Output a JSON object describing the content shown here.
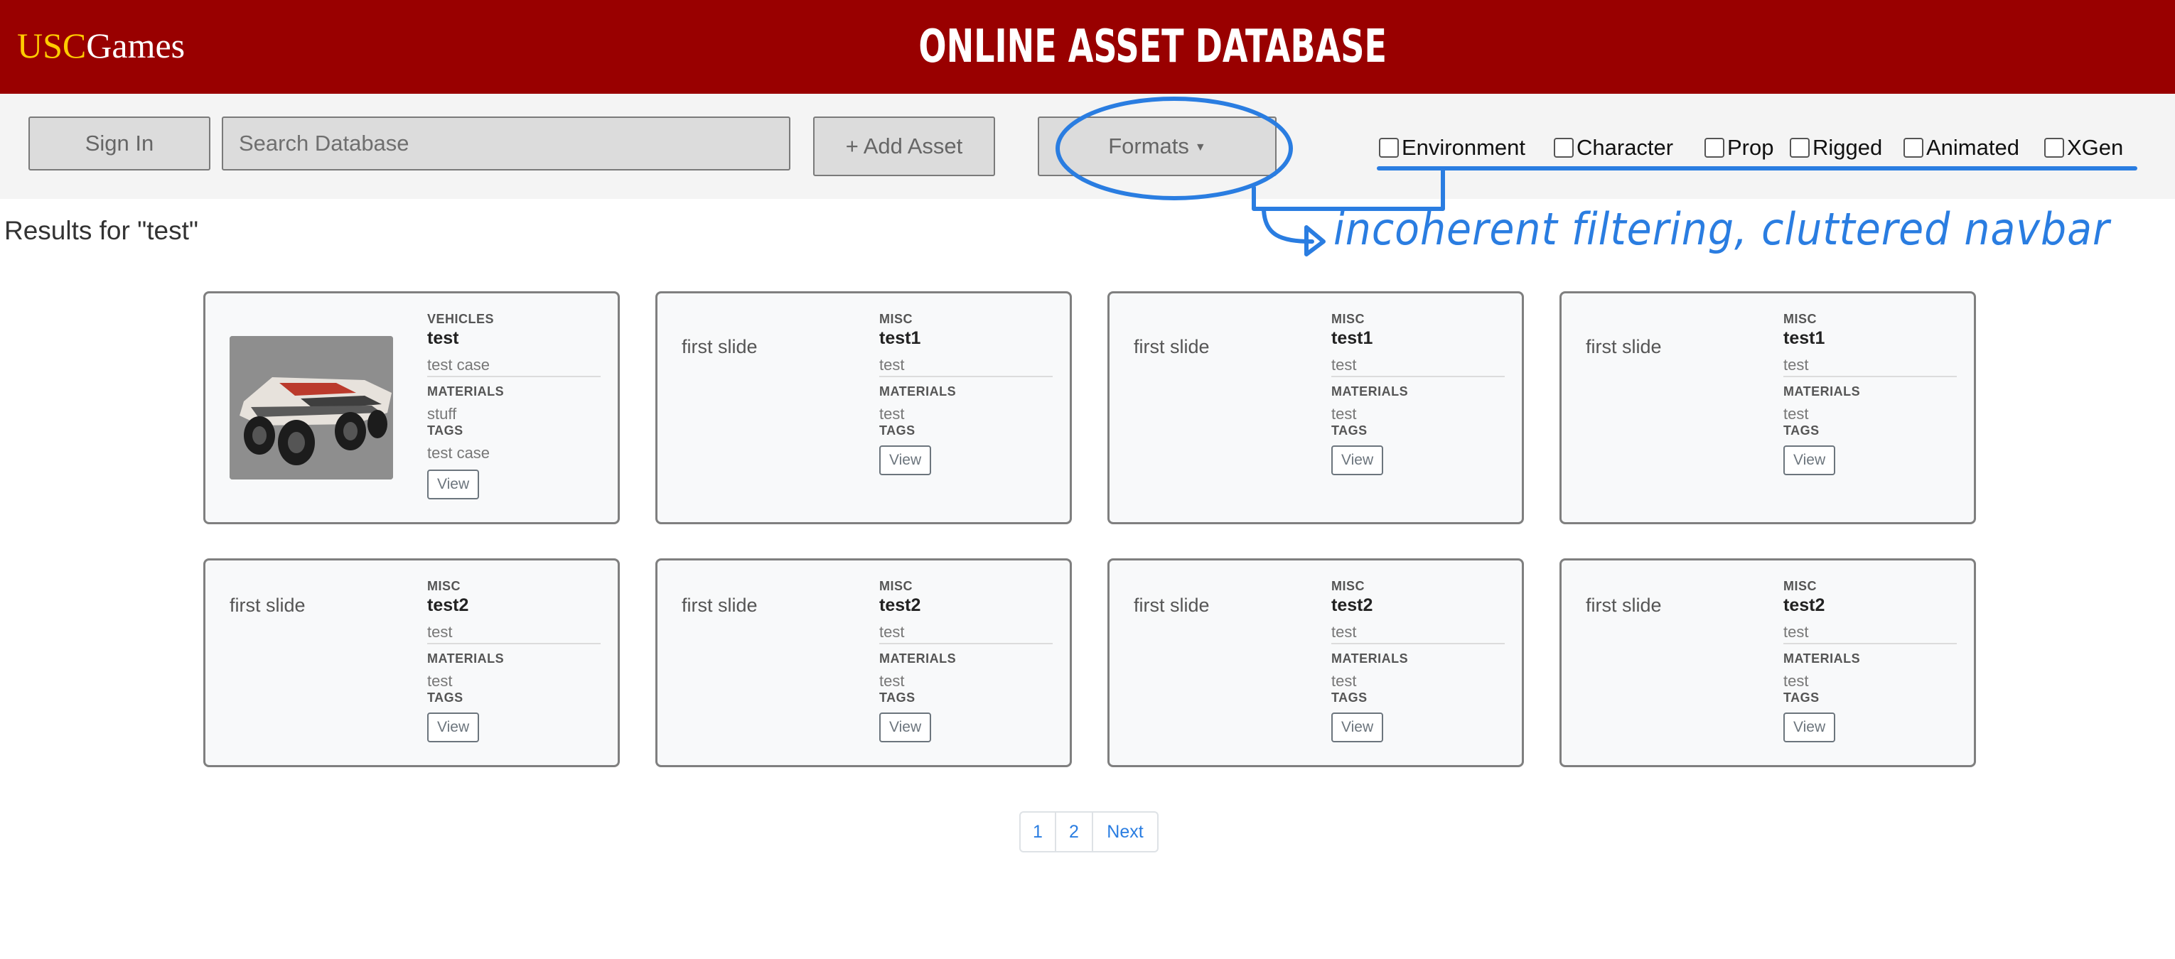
{
  "header": {
    "logo_usc": "USC",
    "logo_games": "Games",
    "title": "ONLINE ASSET DATABASE"
  },
  "navbar": {
    "sign_in": "Sign In",
    "search_placeholder": "Search Database",
    "add_asset": "+ Add Asset",
    "formats": "Formats",
    "filters": [
      "Environment",
      "Character",
      "Prop",
      "Rigged",
      "Animated",
      "XGen"
    ]
  },
  "annotation": {
    "text": "incoherent filtering, cluttered navbar"
  },
  "results": {
    "heading": "Results for \"test\"",
    "labels": {
      "materials": "MATERIALS",
      "tags": "TAGS",
      "view": "View"
    },
    "cards": [
      {
        "image_alt": "",
        "category": "VEHICLES",
        "name": "test",
        "description": "test case",
        "materials": "stuff",
        "tags": "test case"
      },
      {
        "image_alt": "first slide",
        "category": "MISC",
        "name": "test1",
        "description": "test",
        "materials": "test",
        "tags": ""
      },
      {
        "image_alt": "first slide",
        "category": "MISC",
        "name": "test1",
        "description": "test",
        "materials": "test",
        "tags": ""
      },
      {
        "image_alt": "first slide",
        "category": "MISC",
        "name": "test1",
        "description": "test",
        "materials": "test",
        "tags": ""
      },
      {
        "image_alt": "first slide",
        "category": "MISC",
        "name": "test2",
        "description": "test",
        "materials": "test",
        "tags": ""
      },
      {
        "image_alt": "first slide",
        "category": "MISC",
        "name": "test2",
        "description": "test",
        "materials": "test",
        "tags": ""
      },
      {
        "image_alt": "first slide",
        "category": "MISC",
        "name": "test2",
        "description": "test",
        "materials": "test",
        "tags": ""
      },
      {
        "image_alt": "first slide",
        "category": "MISC",
        "name": "test2",
        "description": "test",
        "materials": "test",
        "tags": ""
      }
    ]
  },
  "pagination": {
    "pages": [
      "1",
      "2"
    ],
    "next": "Next"
  },
  "colors": {
    "header_bg": "#990000",
    "logo_gold": "#ffcc00",
    "annotation_blue": "#2a7de1"
  }
}
